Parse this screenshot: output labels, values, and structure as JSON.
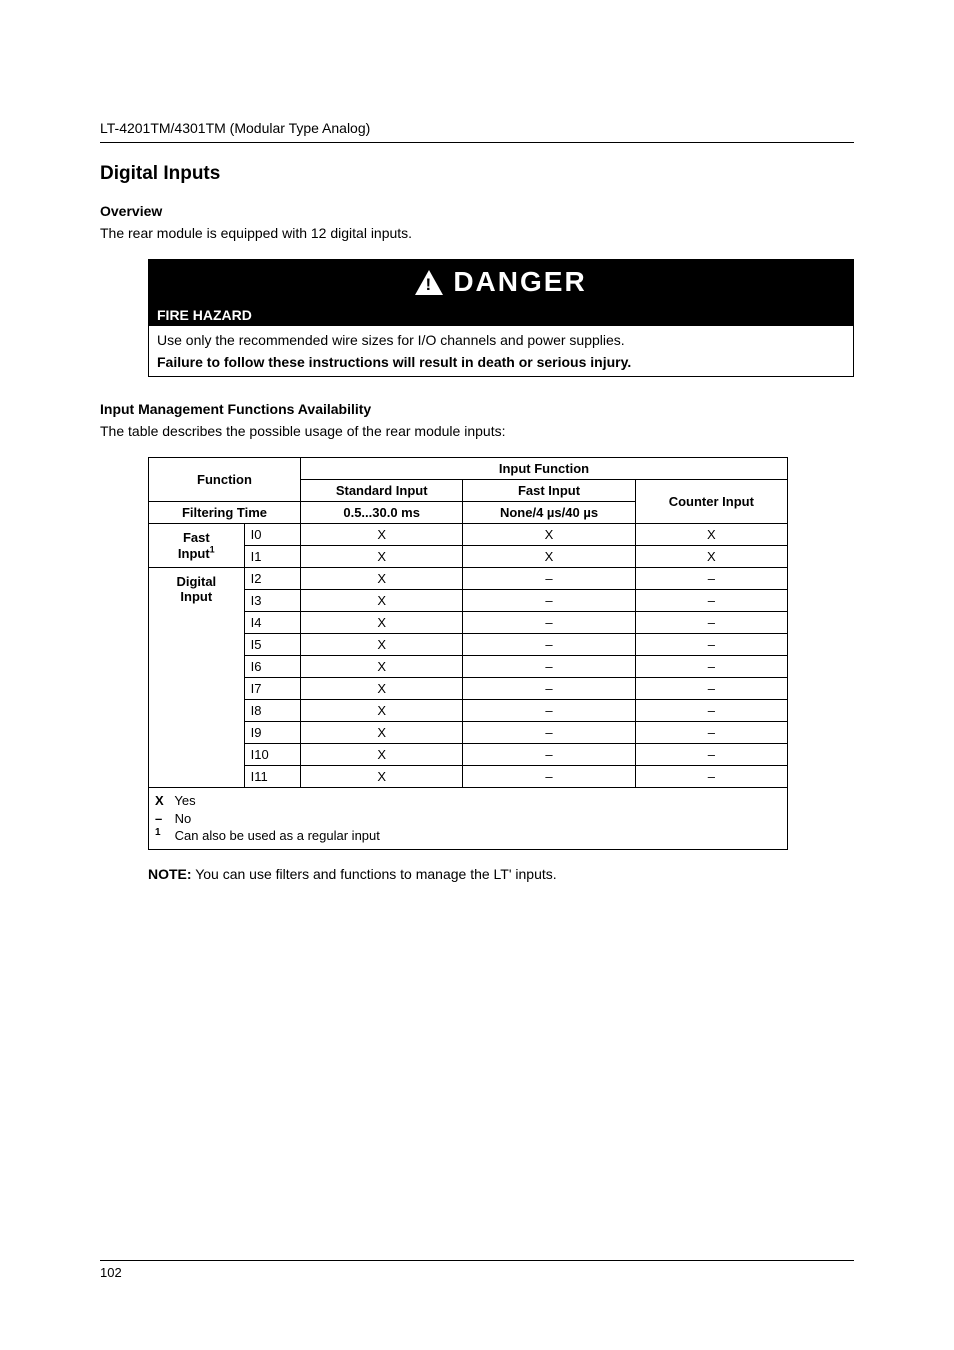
{
  "running_head": "LT-4201TM/4301TM (Modular Type Analog)",
  "section_title": "Digital Inputs",
  "overview": {
    "heading": "Overview",
    "text": "The rear module is equipped with 12 digital inputs."
  },
  "danger": {
    "word": "DANGER",
    "subheading": "FIRE HAZARD",
    "line1": "Use only the recommended wire sizes for I/O channels and power supplies.",
    "line2": "Failure to follow these instructions will result in death or serious injury."
  },
  "imfa": {
    "heading": "Input Management Functions Availability",
    "intro": "The table describes the possible usage of the rear module inputs:"
  },
  "table": {
    "hdr_function": "Function",
    "hdr_input_function": "Input Function",
    "hdr_standard": "Standard Input",
    "hdr_fast": "Fast Input",
    "hdr_counter": "Counter Input",
    "hdr_filtering_time": "Filtering Time",
    "hdr_standard_range": "0.5...30.0 ms",
    "hdr_fast_range": "None/4 µs/40 µs",
    "group_fast_label": "Fast",
    "group_fast_label2_pre": "Input",
    "group_fast_label2_sup": "1",
    "group_digital_label": "Digital",
    "group_digital_label2": "Input",
    "rows": [
      {
        "ch": "I0",
        "std": "X",
        "fast": "X",
        "cnt": "X"
      },
      {
        "ch": "I1",
        "std": "X",
        "fast": "X",
        "cnt": "X"
      },
      {
        "ch": "I2",
        "std": "X",
        "fast": "–",
        "cnt": "–"
      },
      {
        "ch": "I3",
        "std": "X",
        "fast": "–",
        "cnt": "–"
      },
      {
        "ch": "I4",
        "std": "X",
        "fast": "–",
        "cnt": "–"
      },
      {
        "ch": "I5",
        "std": "X",
        "fast": "–",
        "cnt": "–"
      },
      {
        "ch": "I6",
        "std": "X",
        "fast": "–",
        "cnt": "–"
      },
      {
        "ch": "I7",
        "std": "X",
        "fast": "–",
        "cnt": "–"
      },
      {
        "ch": "I8",
        "std": "X",
        "fast": "–",
        "cnt": "–"
      },
      {
        "ch": "I9",
        "std": "X",
        "fast": "–",
        "cnt": "–"
      },
      {
        "ch": "I10",
        "std": "X",
        "fast": "–",
        "cnt": "–"
      },
      {
        "ch": "I11",
        "std": "X",
        "fast": "–",
        "cnt": "–"
      }
    ],
    "legend": {
      "x_sym": "X",
      "x_text": "Yes",
      "dash_sym": "–",
      "dash_text": "No",
      "one_sym": "1",
      "one_text": "Can also be used as a regular input"
    }
  },
  "note": {
    "label": "NOTE:",
    "text": "You can use filters and functions to manage the LT' inputs."
  },
  "page_number": "102"
}
